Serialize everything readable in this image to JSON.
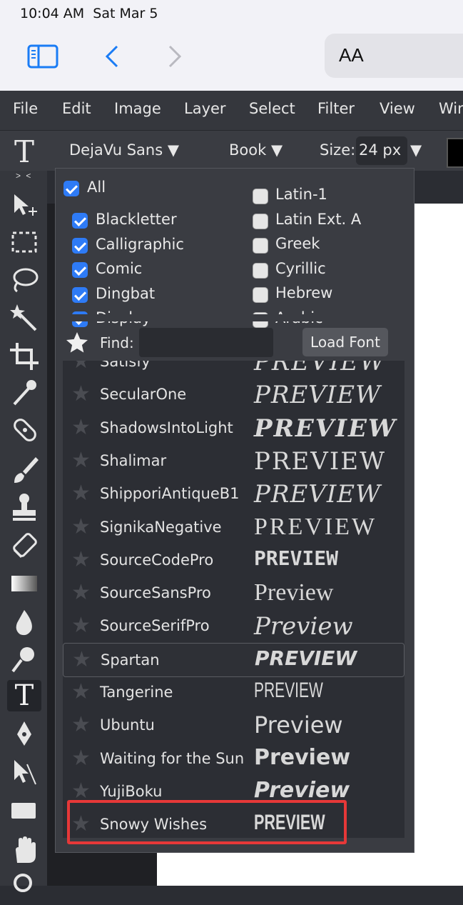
{
  "status": {
    "time": "10:04 AM",
    "date": "Sat Mar 5"
  },
  "browser": {
    "aa_label": "AA"
  },
  "menu": {
    "items": [
      "File",
      "Edit",
      "Image",
      "Layer",
      "Select",
      "Filter",
      "View",
      "Win"
    ]
  },
  "options": {
    "font_family": "DejaVu Sans ▼",
    "font_style": "Book ▼",
    "size_label": "Size:",
    "size_value": "24 px",
    "size_arrow": "▼"
  },
  "toolbar": {
    "collapse": "> <"
  },
  "filters": {
    "all": {
      "label": "All",
      "checked": true
    },
    "left": [
      {
        "label": "Blackletter",
        "checked": true
      },
      {
        "label": "Calligraphic",
        "checked": true
      },
      {
        "label": "Comic",
        "checked": true
      },
      {
        "label": "Dingbat",
        "checked": true
      },
      {
        "label": "Display",
        "checked": true
      }
    ],
    "right": [
      {
        "label": "Latin-1",
        "checked": false
      },
      {
        "label": "Latin Ext. A",
        "checked": false
      },
      {
        "label": "Greek",
        "checked": false
      },
      {
        "label": "Cyrillic",
        "checked": false
      },
      {
        "label": "Hebrew",
        "checked": false
      },
      {
        "label": "Arabic",
        "checked": false
      }
    ]
  },
  "find": {
    "label": "Find:",
    "value": "",
    "load_button": "Load Font"
  },
  "fonts": [
    {
      "name": "Satisfy",
      "preview": "PREVIEW"
    },
    {
      "name": "SecularOne",
      "preview": "PREVIEW"
    },
    {
      "name": "ShadowsIntoLight",
      "preview": "PREVIEW"
    },
    {
      "name": "Shalimar",
      "preview": "PREVIEW"
    },
    {
      "name": "ShipporiAntiqueB1",
      "preview": "PREVIEW"
    },
    {
      "name": "SignikaNegative",
      "preview": "PREVIEW"
    },
    {
      "name": "SourceCodePro",
      "preview": "PREVIEW"
    },
    {
      "name": "SourceSansPro",
      "preview": "Preview"
    },
    {
      "name": "SourceSerifPro",
      "preview": "Preview"
    },
    {
      "name": "Spartan",
      "preview": "PREVIEW"
    },
    {
      "name": "Tangerine",
      "preview": "PREVIEW"
    },
    {
      "name": "Ubuntu",
      "preview": "Preview"
    },
    {
      "name": "Waiting for the Sun",
      "preview": "Preview"
    },
    {
      "name": "YujiBoku",
      "preview": "Preview"
    },
    {
      "name": "Snowy Wishes",
      "preview": "PREVIEW"
    }
  ],
  "colors": {
    "accent": "#2e7bf6",
    "highlight": "#e63838"
  }
}
